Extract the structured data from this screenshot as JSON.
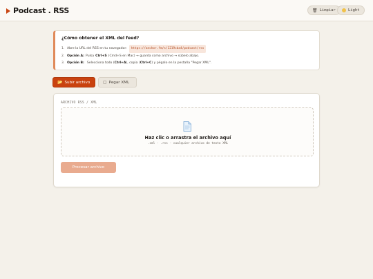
{
  "header": {
    "title": "Podcast . RSS",
    "clear_label": "Limpiar",
    "theme_label": "Light",
    "icons": {
      "brand": "play-icon",
      "clear": "trash-icon",
      "theme": "sun-icon"
    }
  },
  "info": {
    "title": "¿Cómo obtener el XML del feed?",
    "step1": {
      "num": "1.",
      "text": "Abre la URL del RSS en tu navegador:",
      "url": "https://anchor.fm/s/1219cba4/podcast/rss"
    },
    "step2": {
      "num": "2.",
      "opt": "Opción A:",
      "pre": "Pulsa",
      "key": "Ctrl+S",
      "post": "(Cmd+S en Mac) → guarda como archivo → súbelo abajo."
    },
    "step3": {
      "num": "3.",
      "opt": "Opción B:",
      "pre": "Selecciona todo (",
      "key1": "Ctrl+A",
      "mid": "), copia (",
      "key2": "Ctrl+C",
      "post": ") y pégalo en la pestaña \"Pegar XML\"."
    }
  },
  "tabs": [
    {
      "label": "Subir archivo",
      "icon": "folder-icon",
      "active": true
    },
    {
      "label": "Pegar XML",
      "icon": "clipboard-icon",
      "active": false
    }
  ],
  "upload": {
    "section_label": "ARCHIVO RSS / XML",
    "drop_title": "Haz clic o arrastra el archivo aquí",
    "drop_sub": ".xml · .rss · cualquier archivo de texto XML",
    "process_label": "Procesar archivo"
  },
  "colors": {
    "accent": "#c9420f",
    "accent_disabled": "#e9ab8f",
    "background": "#f4f1ea"
  }
}
